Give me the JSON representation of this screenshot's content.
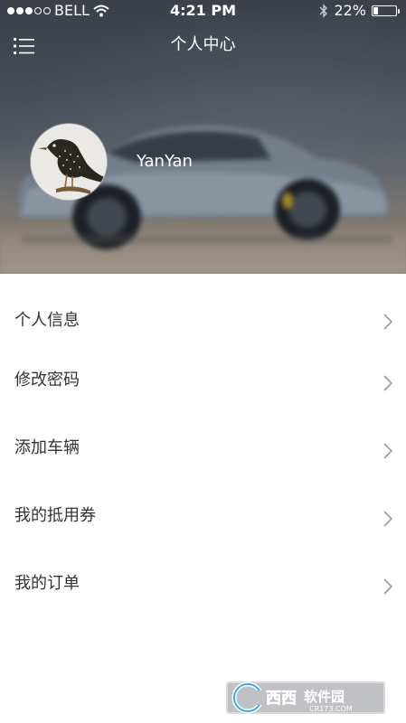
{
  "status_bar": {
    "carrier": "BELL",
    "time": "4:21 PM",
    "battery_percent_text": "22%",
    "battery_level": 0.22,
    "signal_bars_filled": 3,
    "signal_bars_total": 5
  },
  "header": {
    "title": "个人中心",
    "menu_icon": "list-menu-icon"
  },
  "profile": {
    "username": "YanYan",
    "avatar": "bird-avatar"
  },
  "menu": {
    "items": [
      {
        "label": "个人信息",
        "icon": "chevron-right-icon"
      },
      {
        "label": "修改密码",
        "icon": "chevron-right-icon"
      },
      {
        "label": "添加车辆",
        "icon": "chevron-right-icon"
      },
      {
        "label": "我的抵用券",
        "icon": "chevron-right-icon"
      },
      {
        "label": "我的订单",
        "icon": "chevron-right-icon"
      }
    ]
  },
  "watermark": {
    "brand_text": "西西软件园",
    "url_text": "CR173.COM"
  },
  "colors": {
    "text_primary": "#333333",
    "chevron": "#9a9a9a",
    "header_text": "#ffffff",
    "watermark_accent": "#3fa9e1"
  }
}
